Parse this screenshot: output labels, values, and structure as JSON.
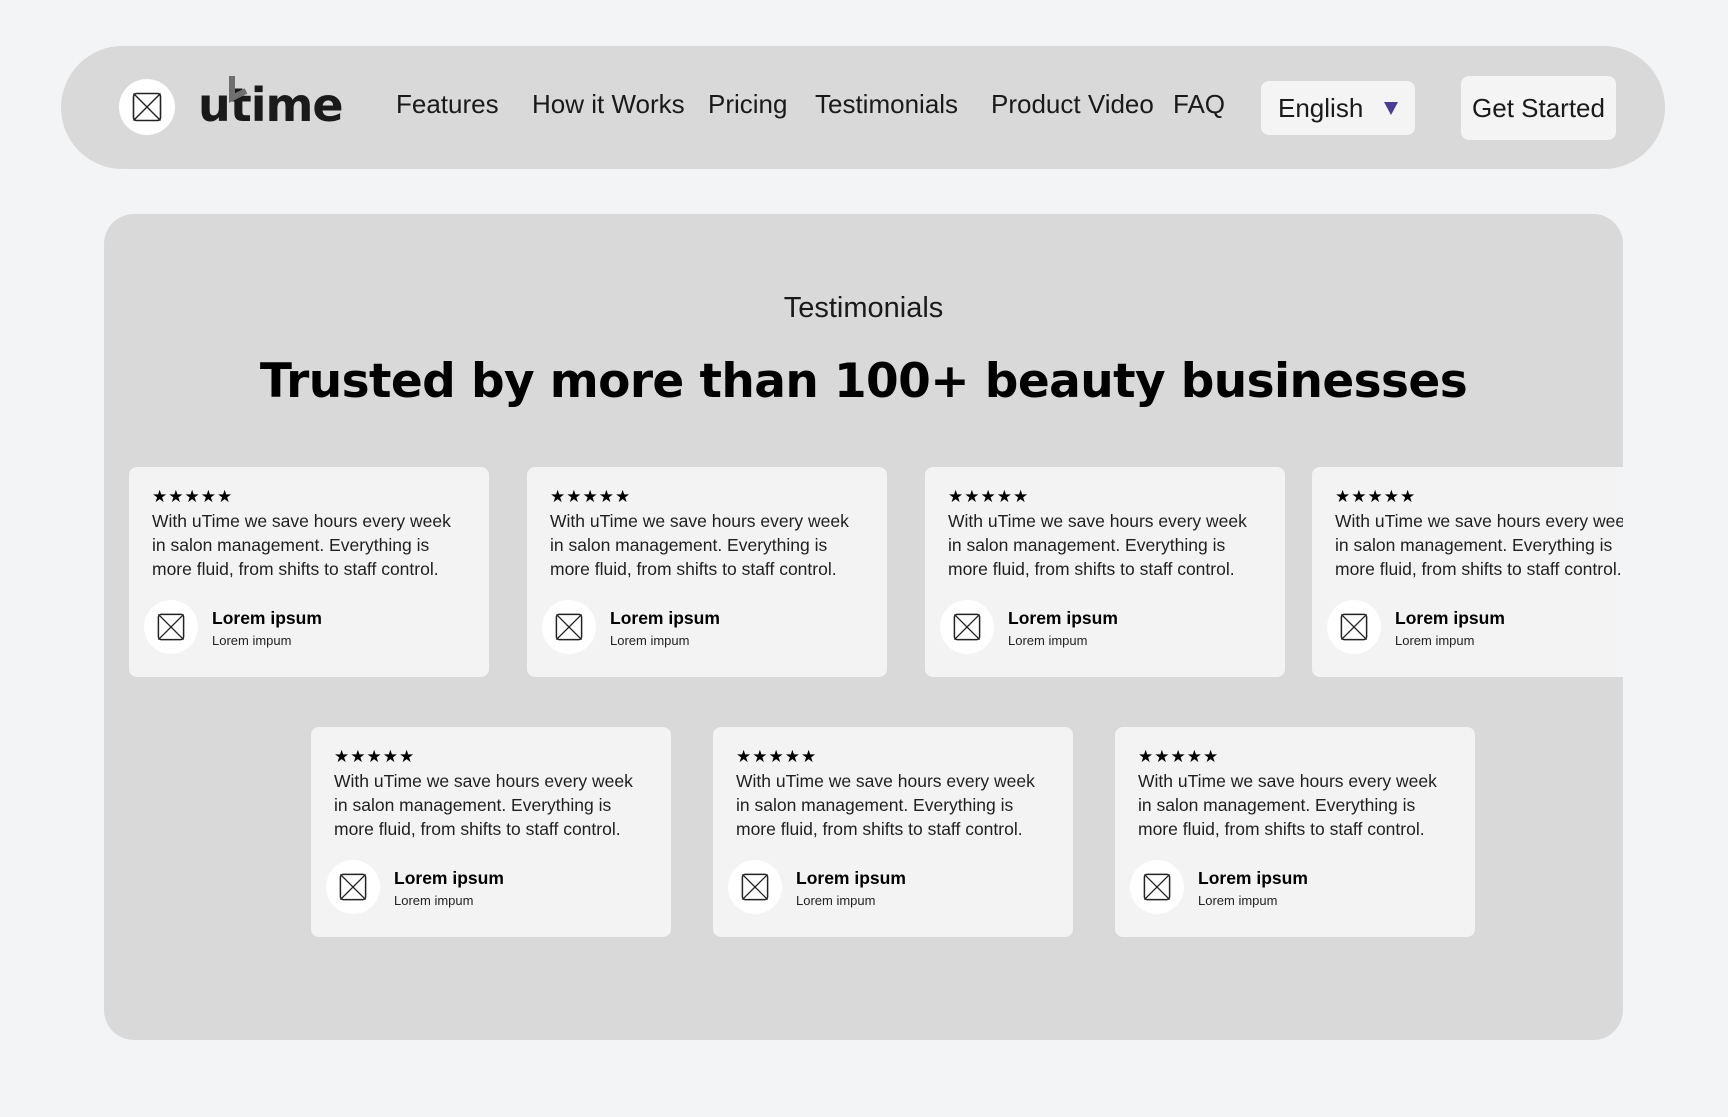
{
  "nav": {
    "logo_text": "utime",
    "links": [
      "Features",
      "How it Works",
      "Pricing",
      "Testimonials",
      "Product Video",
      "FAQ"
    ],
    "language": "English",
    "cta_label": "Get Started",
    "accent_color": "#4b3a96"
  },
  "section": {
    "eyebrow": "Testimonials",
    "headline": "Trusted by more than 100+ beauty businesses"
  },
  "testimonials": [
    {
      "stars": "★★★★★",
      "quote": "With uTime we save hours every week\nin salon management. Everything is\nmore fluid, from shifts to staff control.",
      "name": "Lorem ipsum",
      "role": "Lorem impum"
    },
    {
      "stars": "★★★★★",
      "quote": "With uTime we save hours every week\nin salon management. Everything is\nmore fluid, from shifts to staff control.",
      "name": "Lorem ipsum",
      "role": "Lorem impum"
    },
    {
      "stars": "★★★★★",
      "quote": "With uTime we save hours every week\nin salon management. Everything is\nmore fluid, from shifts to staff control.",
      "name": "Lorem ipsum",
      "role": "Lorem impum"
    },
    {
      "stars": "★★★★★",
      "quote": "With uTime we save hours every week\nin salon management. Everything is\nmore fluid, from shifts to staff control.",
      "name": "Lorem ipsum",
      "role": "Lorem impum"
    },
    {
      "stars": "★★★★★",
      "quote": "With uTime we save hours every week\nin salon management. Everything is\nmore fluid, from shifts to staff control.",
      "name": "Lorem ipsum",
      "role": "Lorem impum"
    },
    {
      "stars": "★★★★★",
      "quote": "With uTime we save hours every week\nin salon management. Everything is\nmore fluid, from shifts to staff control.",
      "name": "Lorem ipsum",
      "role": "Lorem impum"
    },
    {
      "stars": "★★★★★",
      "quote": "With uTime we save hours every week\nin salon management. Everything is\nmore fluid, from shifts to staff control.",
      "name": "Lorem ipsum",
      "role": "Lorem impum"
    }
  ]
}
